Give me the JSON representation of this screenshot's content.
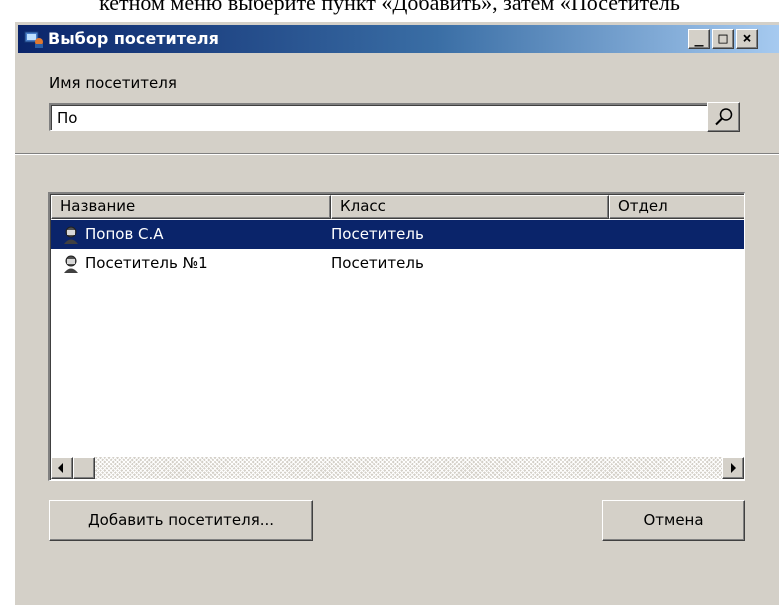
{
  "document": {
    "text": "кетном меню выберите пункт «Добавить», затем «Посетитель"
  },
  "window": {
    "title": "Выбор посетителя",
    "controls": {
      "minimize": "_",
      "maximize": "□",
      "close": "×"
    }
  },
  "search": {
    "label": "Имя посетителя",
    "value": "По",
    "button_icon": "search-icon"
  },
  "list": {
    "columns": [
      "Название",
      "Класс",
      "Отдел"
    ],
    "rows": [
      {
        "name": "Попов С.А",
        "class": "Посетитель",
        "department": "",
        "selected": true,
        "icon": "person-icon"
      },
      {
        "name": "Посетитель №1",
        "class": "Посетитель",
        "department": "",
        "selected": false,
        "icon": "person-icon"
      }
    ]
  },
  "buttons": {
    "add": "Добавить посетителя...",
    "cancel": "Отмена"
  },
  "colors": {
    "face": "#d4d0c8",
    "selection": "#0a246a",
    "title_start": "#0a246a",
    "title_end": "#a6caf0"
  }
}
